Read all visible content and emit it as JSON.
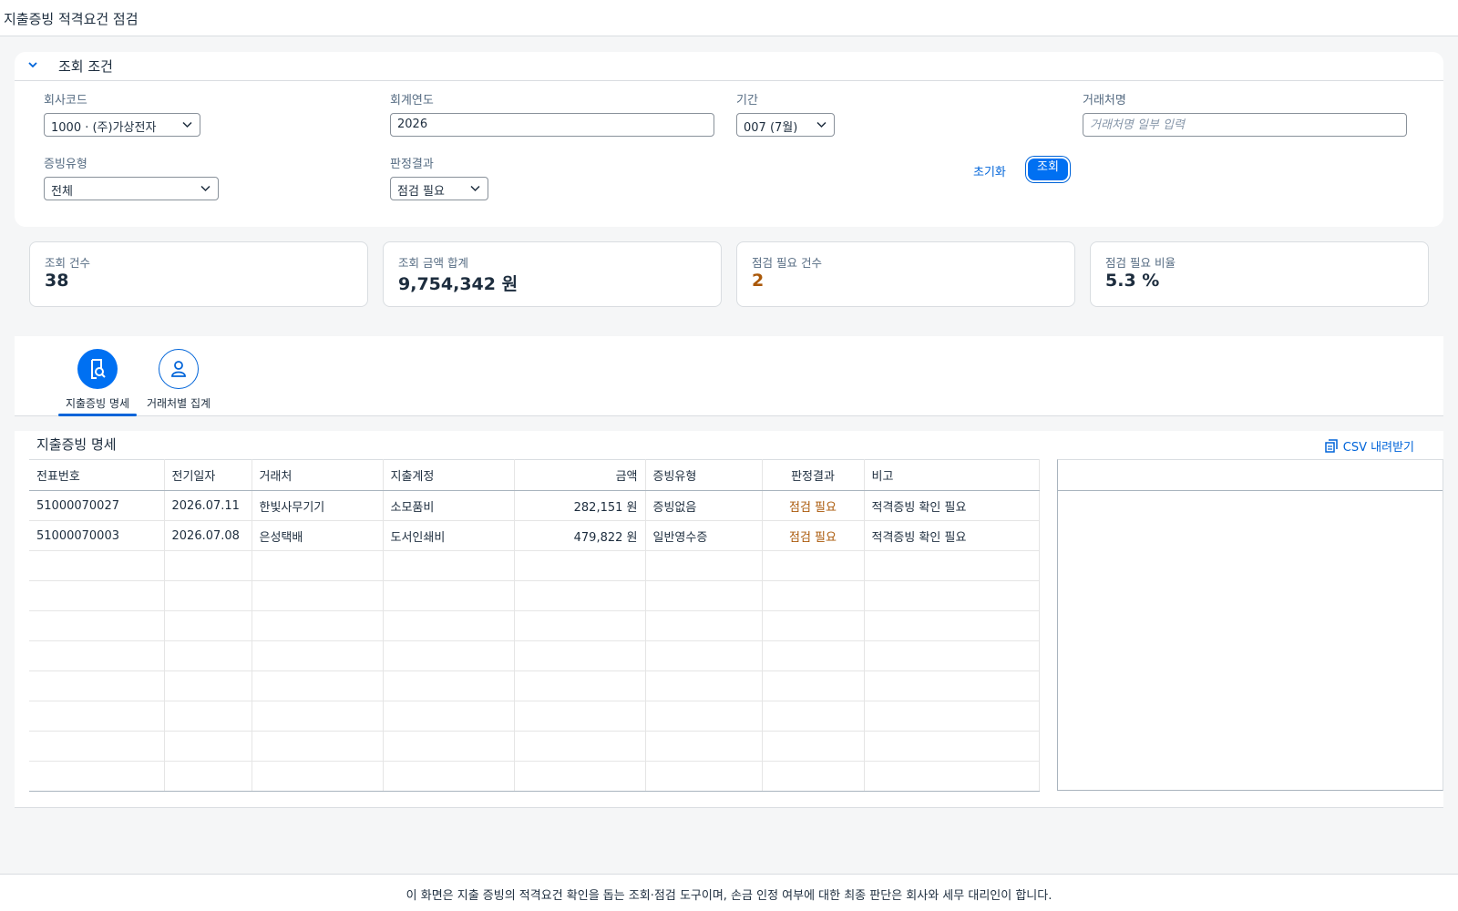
{
  "app": {
    "title": "지출증빙 적격요건 점검"
  },
  "filter": {
    "title": "조회 조건",
    "company": {
      "label": "회사코드",
      "value": "1000 · (주)가상전자"
    },
    "year": {
      "label": "회계연도",
      "value": "2026"
    },
    "period": {
      "label": "기간",
      "value": "007 (7월)"
    },
    "vendor": {
      "label": "거래처명",
      "placeholder": "거래처명 일부 입력"
    },
    "evidence_type": {
      "label": "증빙유형",
      "value": "전체"
    },
    "result": {
      "label": "판정결과",
      "value": "점검 필요"
    },
    "reset_label": "초기화",
    "go_label": "조회"
  },
  "kpis": [
    {
      "label": "조회 건수",
      "value": "38"
    },
    {
      "label": "조회 금액 합계",
      "value": "9,754,342 원"
    },
    {
      "label": "점검 필요 건수",
      "value": "2"
    },
    {
      "label": "점검 필요 비율",
      "value": "5.3 %"
    }
  ],
  "tabs": [
    {
      "label": "지출증빙 명세",
      "icon": "document-search-icon"
    },
    {
      "label": "거래처별 집계",
      "icon": "person-icon"
    }
  ],
  "table": {
    "title": "지출증빙 명세",
    "csv_label": "CSV 내려받기",
    "headers": [
      "전표번호",
      "전기일자",
      "거래처",
      "지출계정",
      "금액",
      "증빙유형",
      "판정결과",
      "비고"
    ],
    "rows": [
      [
        "51000070027",
        "2026.07.11",
        "한빛사무기기",
        "소모품비",
        "282,151 원",
        "증빙없음",
        "점검 필요",
        "적격증빙 확인 필요"
      ],
      [
        "51000070003",
        "2026.07.08",
        "은성택배",
        "도서인쇄비",
        "479,822 원",
        "일반영수증",
        "점검 필요",
        "적격증빙 확인 필요"
      ]
    ]
  },
  "footer": {
    "text": "이 화면은 지출 증빙의 적격요건 확인을 돕는 조회·점검 도구이며, 손금 인정 여부에 대한 최종 판단은 회사와 세무 대리인이 합니다."
  },
  "colors": {
    "accent": "#0070f2",
    "warning": "#aa5808",
    "text": "#1d2d3e",
    "muted": "#556b82"
  }
}
